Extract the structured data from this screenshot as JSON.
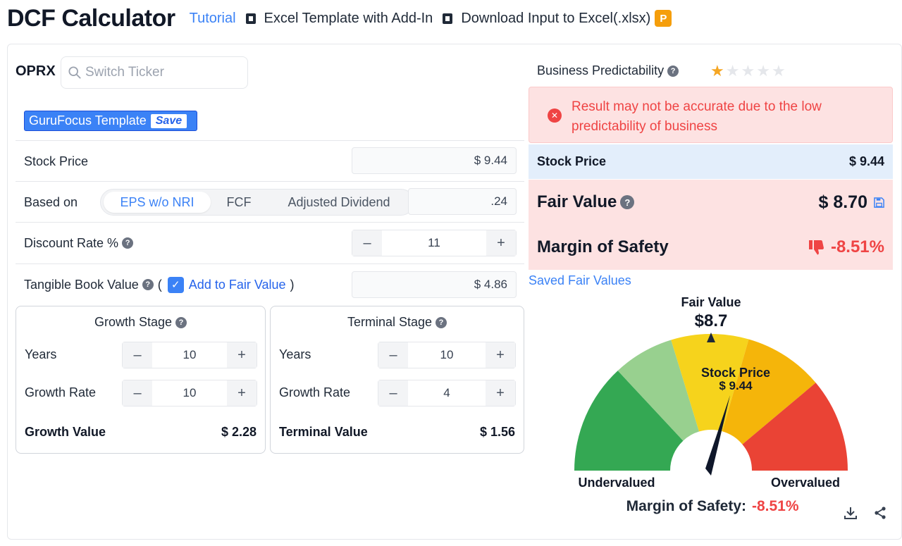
{
  "header": {
    "title": "DCF Calculator",
    "tutorial": "Tutorial",
    "excel_template": "Excel Template with Add-In",
    "download_input": "Download Input to Excel(.xlsx)",
    "premium_badge": "P"
  },
  "ticker": {
    "symbol": "OPRX",
    "search_placeholder": "Switch Ticker"
  },
  "template": {
    "label": "GuruFocus Template",
    "save": "Save"
  },
  "inputs": {
    "stock_price_label": "Stock Price",
    "stock_price_value": "$ 9.44",
    "based_on_label": "Based on",
    "based_on_options": [
      "EPS w/o NRI",
      "FCF",
      "Adjusted Dividend"
    ],
    "based_on_selected": "EPS w/o NRI",
    "based_on_value": ".24",
    "discount_rate_label": "Discount Rate %",
    "discount_rate_value": "11",
    "tbv_label": "Tangible Book Value",
    "tbv_open": "(",
    "tbv_close": ")",
    "add_to_fair_value": "Add to Fair Value",
    "tbv_value": "$ 4.86"
  },
  "growth_stage": {
    "title": "Growth Stage",
    "years_label": "Years",
    "years": "10",
    "rate_label": "Growth Rate",
    "rate": "10",
    "total_label": "Growth Value",
    "total": "$ 2.28"
  },
  "terminal_stage": {
    "title": "Terminal Stage",
    "years_label": "Years",
    "years": "10",
    "rate_label": "Growth Rate",
    "rate": "4",
    "total_label": "Terminal Value",
    "total": "$ 1.56"
  },
  "predictability": {
    "label": "Business Predictability",
    "stars": 1,
    "max_stars": 5
  },
  "alert": {
    "text": "Result may not be accurate due to the low predictability of business"
  },
  "summary": {
    "stock_price_label": "Stock Price",
    "stock_price": "$ 9.44",
    "fair_value_label": "Fair Value",
    "fair_value": "$ 8.70",
    "mos_label": "Margin of Safety",
    "mos": "-8.51%"
  },
  "saved_fair_values": "Saved Fair Values",
  "gauge": {
    "fair_value_label": "Fair Value",
    "fair_value": "$8.7",
    "stock_price_label": "Stock Price",
    "stock_price": "$ 9.44",
    "undervalued": "Undervalued",
    "overvalued": "Overvalued",
    "mos_label": "Margin of Safety:",
    "mos": "-8.51%",
    "colors": [
      "#34a853",
      "#98d08f",
      "#f6d31c",
      "#f5b50a",
      "#ea4335"
    ]
  },
  "colors": {
    "accent": "#3b82f6",
    "negative": "#ef4444",
    "star": "#f5a623"
  }
}
